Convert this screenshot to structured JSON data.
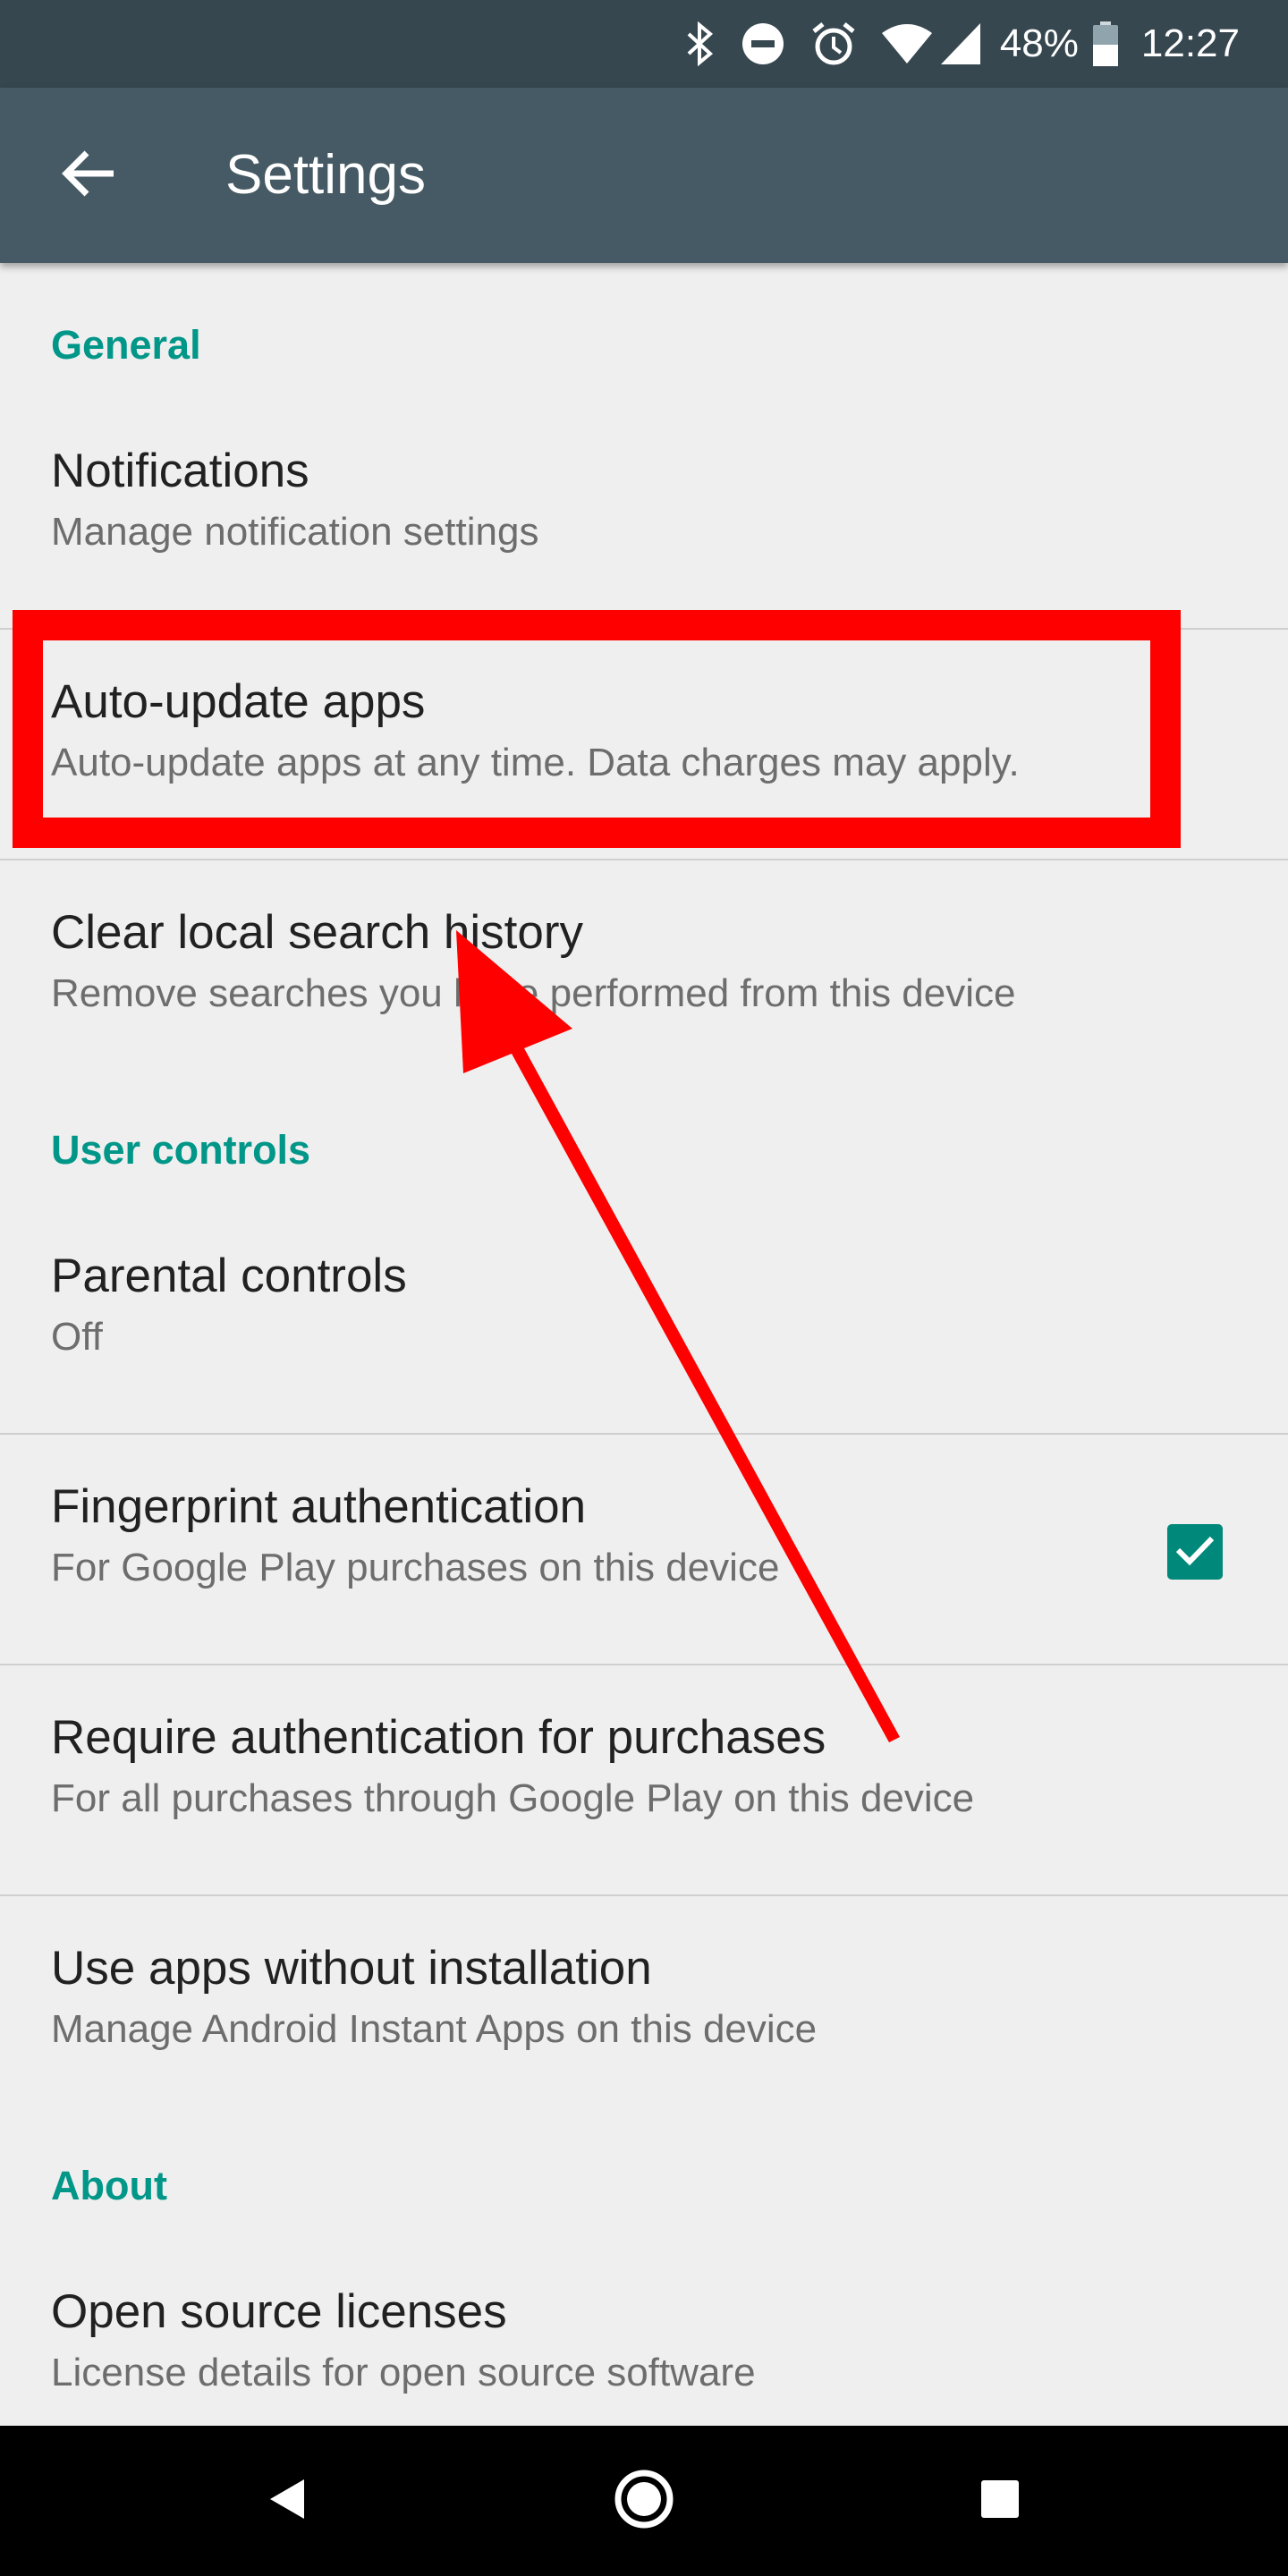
{
  "status_bar": {
    "battery": "48%",
    "time": "12:27",
    "icons": [
      "bluetooth-icon",
      "do-not-disturb-icon",
      "alarm-icon",
      "wifi-icon",
      "signal-icon",
      "battery-icon"
    ]
  },
  "app_bar": {
    "title": "Settings",
    "back_icon": "arrow-back-icon"
  },
  "sections": {
    "general": "General",
    "user_controls": "User controls",
    "about": "About"
  },
  "settings": {
    "notifications": {
      "title": "Notifications",
      "summary": "Manage notification settings"
    },
    "auto_update": {
      "title": "Auto-update apps",
      "summary": "Auto-update apps at any time. Data charges may apply."
    },
    "clear_history": {
      "title": "Clear local search history",
      "summary": "Remove searches you have performed from this device"
    },
    "parental": {
      "title": "Parental controls",
      "summary": "Off"
    },
    "fingerprint": {
      "title": "Fingerprint authentication",
      "summary": "For Google Play purchases on this device",
      "checked": true
    },
    "require_auth": {
      "title": "Require authentication for purchases",
      "summary": "For all purchases through Google Play on this device"
    },
    "instant_apps": {
      "title": "Use apps without installation",
      "summary": "Manage Android Instant Apps on this device"
    },
    "licenses": {
      "title": "Open source licenses",
      "summary": "License details for open source software"
    }
  },
  "nav_bar": {
    "icons": [
      "nav-back-icon",
      "nav-home-icon",
      "nav-recents-icon"
    ]
  },
  "colors": {
    "status_bar": "#37474f",
    "app_bar": "#455a64",
    "accent": "#009688",
    "annotation": "#ff0000"
  }
}
